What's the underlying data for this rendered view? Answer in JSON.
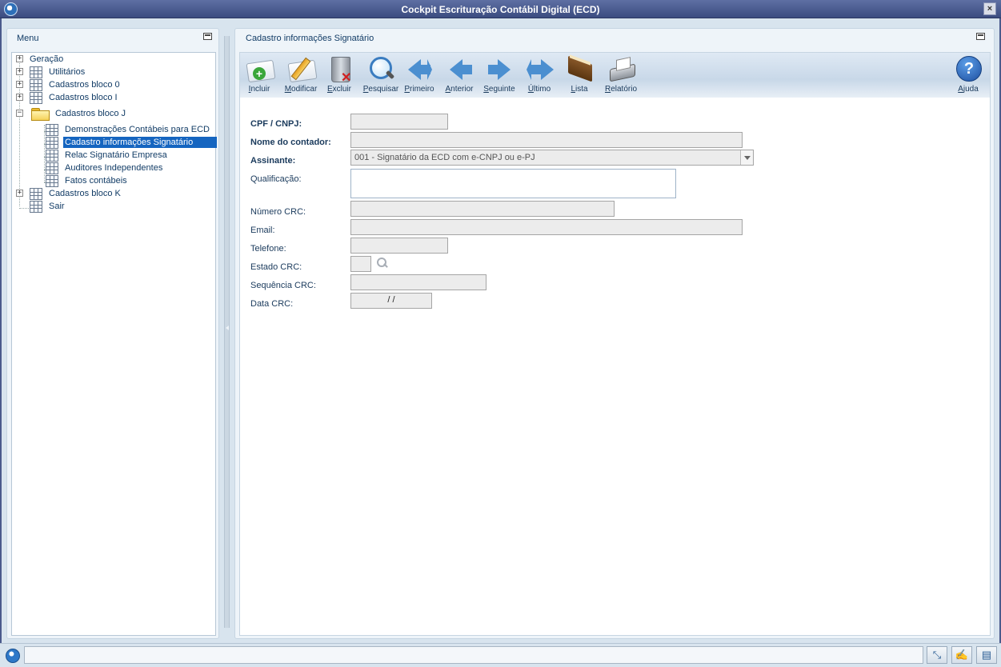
{
  "window": {
    "title": "Cockpit Escrituração Contábil Digital (ECD)"
  },
  "menu": {
    "title": "Menu",
    "items": [
      {
        "label": "Geração"
      },
      {
        "label": "Utilitários"
      },
      {
        "label": "Cadastros bloco 0"
      },
      {
        "label": "Cadastros bloco I"
      },
      {
        "label": "Cadastros bloco J",
        "children": [
          {
            "label": "Demonstrações Contábeis para ECD"
          },
          {
            "label": "Cadastro informações Signatário",
            "selected": true
          },
          {
            "label": "Relac Signatário Empresa"
          },
          {
            "label": "Auditores Independentes"
          },
          {
            "label": "Fatos contábeis"
          }
        ]
      },
      {
        "label": "Cadastros bloco K"
      },
      {
        "label": "Sair"
      }
    ]
  },
  "content": {
    "title": "Cadastro informações Signatário",
    "toolbar": [
      {
        "label": "Incluir",
        "icon": "add-document-icon"
      },
      {
        "label": "Modificar",
        "icon": "edit-document-icon"
      },
      {
        "label": "Excluir",
        "icon": "trash-icon"
      },
      {
        "label": "Pesquisar",
        "icon": "magnifier-icon"
      },
      {
        "label": "Primeiro",
        "icon": "first-record-icon"
      },
      {
        "label": "Anterior",
        "icon": "previous-record-icon"
      },
      {
        "label": "Seguinte",
        "icon": "next-record-icon"
      },
      {
        "label": "Último",
        "icon": "last-record-icon"
      },
      {
        "label": "Lista",
        "icon": "book-list-icon"
      },
      {
        "label": "Relatório",
        "icon": "printer-icon"
      },
      {
        "label": "Ajuda",
        "icon": "help-icon"
      }
    ],
    "form": {
      "cpf_cnpj": {
        "label": "CPF / CNPJ:",
        "value": ""
      },
      "nome_contador": {
        "label": "Nome do contador:",
        "value": ""
      },
      "assinante": {
        "label": "Assinante:",
        "value": "001 - Signatário da ECD com e-CNPJ ou e-PJ"
      },
      "qualificacao": {
        "label": "Qualificação:",
        "value": ""
      },
      "numero_crc": {
        "label": "Número CRC:",
        "value": ""
      },
      "email": {
        "label": "Email:",
        "value": ""
      },
      "telefone": {
        "label": "Telefone:",
        "value": ""
      },
      "estado_crc": {
        "label": "Estado CRC:",
        "value": ""
      },
      "sequencia_crc": {
        "label": "Sequência CRC:",
        "value": ""
      },
      "data_crc": {
        "label": "Data CRC:",
        "value": "/ /"
      }
    }
  },
  "colors": {
    "title_bar": "#4a5a8c",
    "selection": "#1565c0",
    "panel_bg": "#eef4f9",
    "accent_arrow": "#4b8fd0"
  }
}
